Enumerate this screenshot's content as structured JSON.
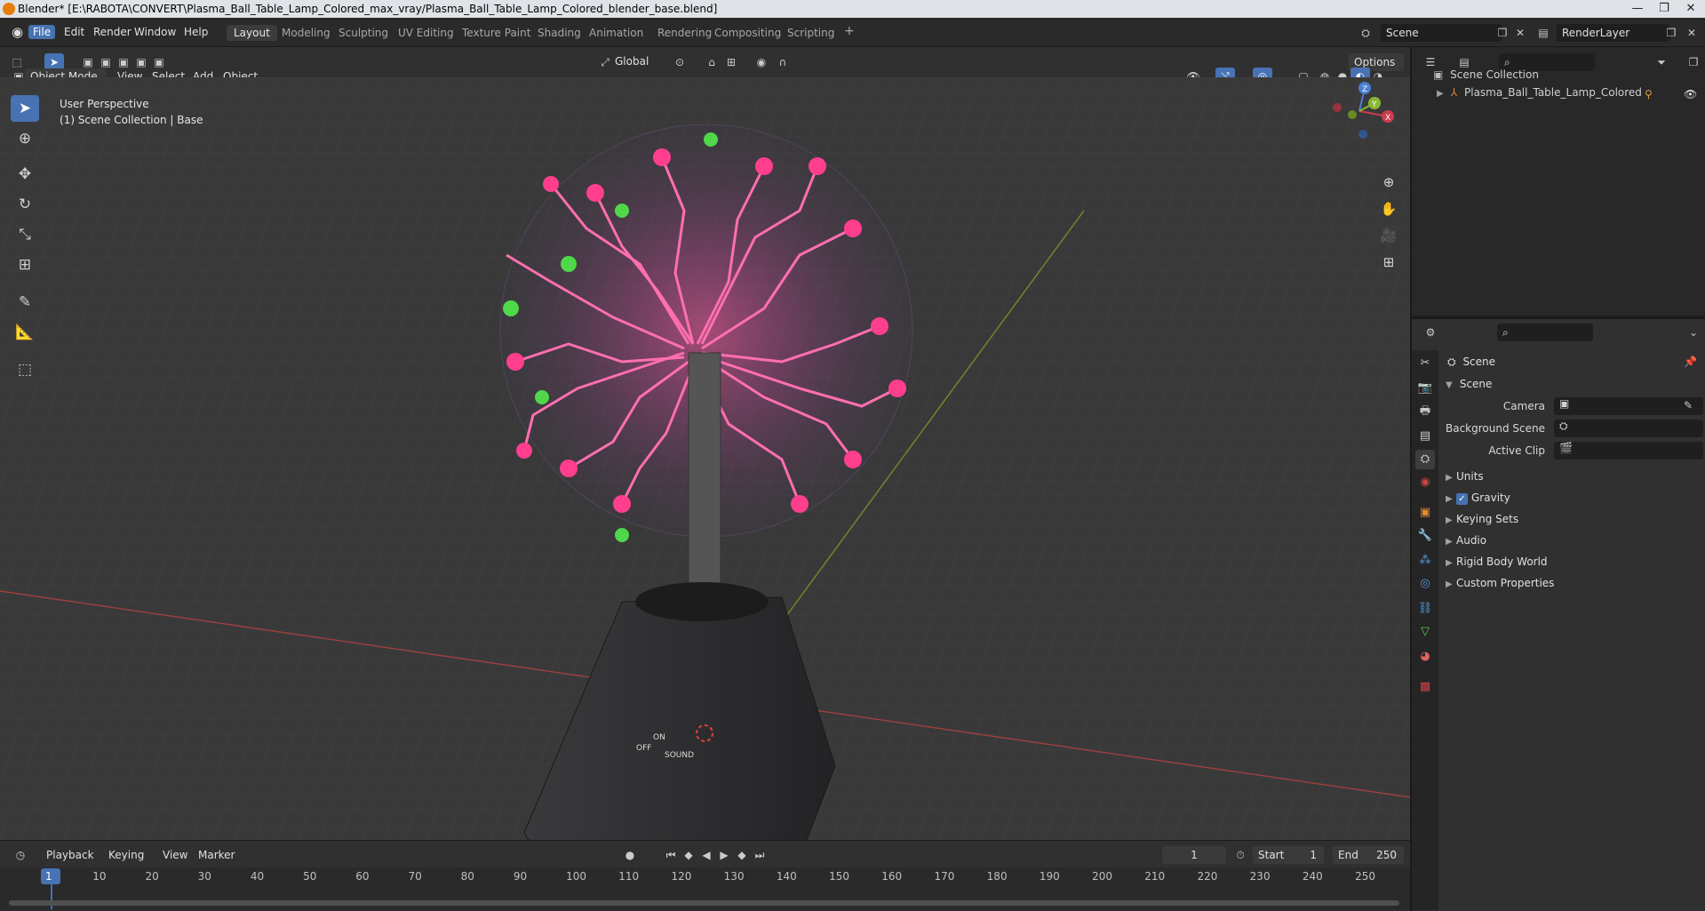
{
  "window": {
    "title": "Blender* [E:\\RABOTA\\CONVERT\\Plasma_Ball_Table_Lamp_Colored_max_vray/Plasma_Ball_Table_Lamp_Colored_blender_base.blend]",
    "minimize": "—",
    "maximize": "❐",
    "close": "✕"
  },
  "menu": [
    "File",
    "Edit",
    "Render",
    "Window",
    "Help"
  ],
  "workspaces": [
    "Layout",
    "Modeling",
    "Sculpting",
    "UV Editing",
    "Texture Paint",
    "Shading",
    "Animation",
    "Rendering",
    "Compositing",
    "Scripting"
  ],
  "add_workspace": "+",
  "scene_field": "Scene",
  "renderlayer_field": "RenderLayer",
  "header3d": {
    "mode": "Object Mode",
    "menus": [
      "View",
      "Select",
      "Add",
      "Object"
    ],
    "orientation": "Global",
    "options": "Options"
  },
  "viewport": {
    "perspective": "User Perspective",
    "collection": "(1) Scene Collection | Base",
    "gizmo_axes": {
      "z": "Z",
      "y": "Y",
      "x": "X"
    },
    "base_labels": {
      "on": "ON",
      "off": "OFF",
      "sound": "SOUND"
    }
  },
  "outliner": {
    "root": "Scene Collection",
    "items": [
      "Plasma_Ball_Table_Lamp_Colored"
    ]
  },
  "properties": {
    "context": "Scene",
    "panel": "Scene",
    "fields": [
      {
        "label": "Camera"
      },
      {
        "label": "Background Scene"
      },
      {
        "label": "Active Clip"
      }
    ],
    "subpanels": [
      "Units",
      "Gravity",
      "Keying Sets",
      "Audio",
      "Rigid Body World",
      "Custom Properties"
    ],
    "gravity_checked": true
  },
  "timeline": {
    "menus": [
      "Playback",
      "Keying",
      "View",
      "Marker"
    ],
    "current_frame": "1",
    "start_label": "Start",
    "start": "1",
    "end_label": "End",
    "end": "250",
    "ticks": [
      "1",
      "10",
      "20",
      "30",
      "40",
      "50",
      "60",
      "70",
      "80",
      "90",
      "100",
      "110",
      "120",
      "130",
      "140",
      "150",
      "160",
      "170",
      "180",
      "190",
      "200",
      "210",
      "220",
      "230",
      "240",
      "250"
    ]
  },
  "colors": {
    "accent": "#4772b3",
    "plasma": "#ff4f9a",
    "plasma_tip_green": "#55e04a",
    "base_dark": "#2b2b2d",
    "x_axis": "#b8423f",
    "y_axis": "#7b9a2e"
  }
}
